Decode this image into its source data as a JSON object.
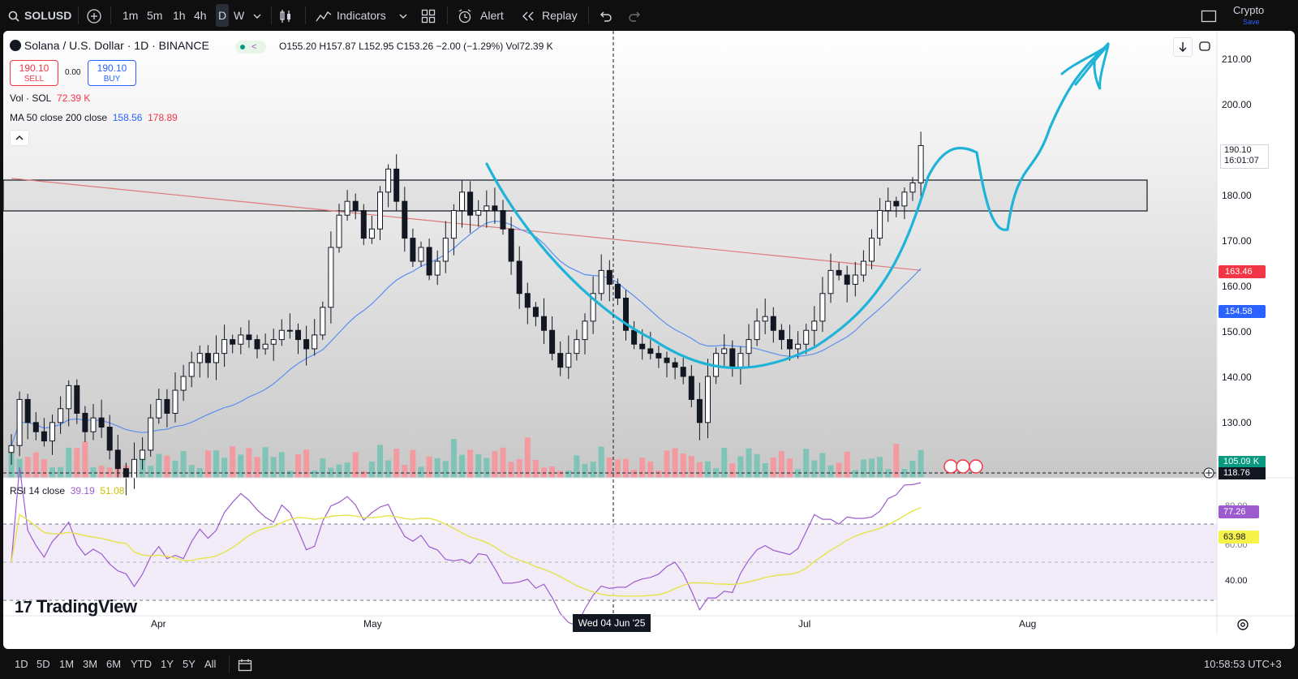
{
  "toolbar": {
    "symbol": "SOLUSD",
    "intervals": [
      "1m",
      "5m",
      "1h",
      "4h",
      "D",
      "W"
    ],
    "active_interval": "D",
    "indicators_label": "Indicators",
    "alert_label": "Alert",
    "replay_label": "Replay",
    "account_label": "Crypto",
    "account_sub": "Save",
    "icons": [
      "search-icon",
      "add-icon",
      "chevron-down-icon",
      "candles-icon",
      "indicators-icon",
      "layout-icon",
      "alert-icon",
      "replay-icon",
      "undo-icon",
      "redo-icon",
      "fullscreen-icon"
    ]
  },
  "legend": {
    "title": "Solana / U.S. Dollar · 1D · BINANCE",
    "ohlc": "O155.20  H157.87  L152.95  C153.26  −2.00 (−1.29%)  Vol72.39 K",
    "sell_price": "190.10",
    "sell_label": "SELL",
    "spread": "0.00",
    "buy_price": "190.10",
    "buy_label": "BUY",
    "vol_label": "Vol · SOL",
    "vol_value": "72.39 K",
    "ma_label": "MA 50 close 200 close",
    "ma50_value": "158.56",
    "ma200_value": "178.89",
    "rsi_label": "RSI 14 close",
    "rsi_value": "39.19",
    "rsi_ma_value": "51.08"
  },
  "price_axis": {
    "ticks": [
      "210.00",
      "200.00",
      "190.00",
      "180.00",
      "170.00",
      "160.00",
      "150.00",
      "140.00",
      "130.00"
    ],
    "last_price": "190.10",
    "countdown": "16:01:07",
    "ma200_tag": "163.46",
    "ma50_tag": "154.58",
    "volume_tag": "105.09 K",
    "crosshair_price": "118.76"
  },
  "rsi_axis": {
    "ticks": [
      "80.00",
      "60.00",
      "40.00"
    ],
    "rsi_tag": "77.26",
    "rsi_ma_tag": "63.98"
  },
  "time_axis": {
    "labels": [
      "Apr",
      "May",
      "Jul",
      "Aug"
    ],
    "crosshair_label": "Wed 04 Jun '25"
  },
  "watermark": "TradingView",
  "bottom": {
    "ranges": [
      "1D",
      "5D",
      "1M",
      "3M",
      "6M",
      "YTD",
      "1Y",
      "5Y",
      "All"
    ],
    "clock": "10:58:53 UTC+3"
  },
  "colors": {
    "up": "#089981",
    "down": "#f23645",
    "vol_up": "#7fc4b7",
    "vol_down": "#f29aa0",
    "ma50": "#5b8ff0",
    "ma200": "#e07a7a",
    "rsi": "#9d5bd0",
    "rsi_ma": "#e6e24a",
    "drawing": "#1fb3d8"
  },
  "chart_data": {
    "type": "candlestick",
    "symbol": "SOLUSD",
    "timeframe": "1D",
    "ylim": [
      118,
      215
    ],
    "approx_closes": [
      125,
      135,
      130,
      128,
      126,
      130,
      133,
      138,
      132,
      128,
      131,
      129,
      124,
      120,
      118,
      122,
      124,
      131,
      135,
      132,
      137,
      140,
      143,
      145,
      143,
      145,
      148,
      147,
      149,
      148,
      146,
      147,
      148,
      150,
      150,
      148,
      146,
      149,
      155,
      168,
      175,
      178,
      176,
      170,
      172,
      180,
      185,
      178,
      170,
      165,
      168,
      162,
      165,
      170,
      176,
      180,
      175,
      176,
      177,
      176,
      172,
      165,
      158,
      155,
      153,
      150,
      145,
      142,
      145,
      148,
      152,
      158,
      163,
      160,
      157,
      150,
      147,
      146,
      145,
      144,
      143,
      142,
      140,
      135,
      130,
      140,
      145,
      146,
      142,
      145,
      148,
      152,
      153,
      150,
      148,
      146,
      147,
      150,
      152,
      158,
      163,
      162,
      160,
      162,
      165,
      170,
      176,
      178,
      177,
      180,
      182,
      190.1
    ],
    "price_levels": [
      {
        "label": "last",
        "value": 190.1
      },
      {
        "label": "MA 200",
        "value": 163.46
      },
      {
        "label": "MA 50",
        "value": 154.58
      }
    ],
    "resistance_zone": [
      177,
      184
    ],
    "rsi": {
      "ylim": [
        30,
        85
      ],
      "current": 77.26,
      "ma_current": 63.98,
      "bands": [
        70,
        50,
        30
      ]
    }
  }
}
